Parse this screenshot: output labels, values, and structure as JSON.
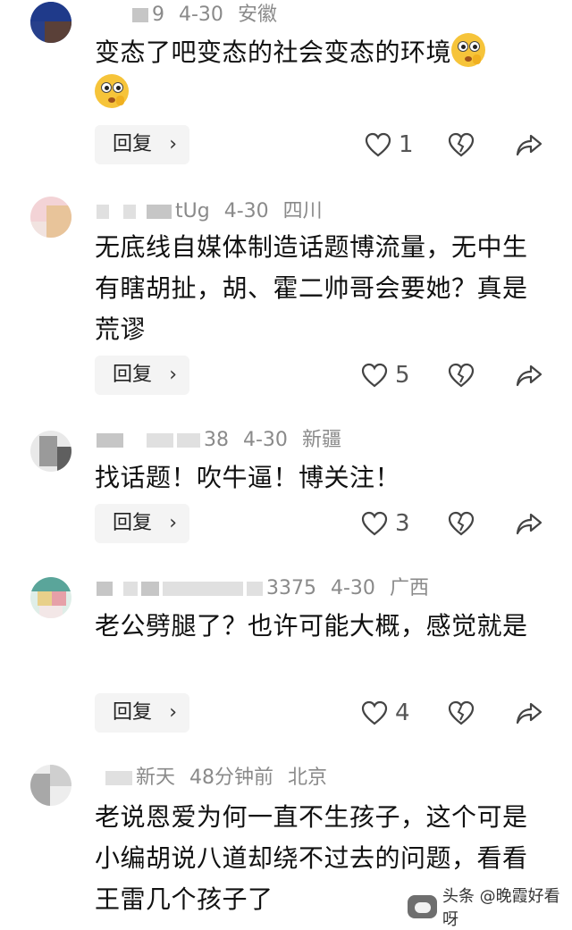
{
  "comments": [
    {
      "name_visible": "9",
      "date": "4-30",
      "location": "安徽",
      "text": "变态了吧变态的社会变态的环境",
      "likes": "1",
      "reply_label": "回复"
    },
    {
      "name_visible": "tUg",
      "date": "4-30",
      "location": "四川",
      "text": "无底线自媒体制造话题博流量，无中生有瞎胡扯，胡、霍二帅哥会要她？真是荒谬",
      "likes": "5",
      "reply_label": "回复"
    },
    {
      "name_visible": "38",
      "date": "4-30",
      "location": "新疆",
      "text": "找话题！吹牛逼！博关注！",
      "likes": "3",
      "reply_label": "回复"
    },
    {
      "name_visible": "3375",
      "date": "4-30",
      "location": "广西",
      "text": "老公劈腿了？也许可能大概，感觉就是",
      "likes": "4",
      "reply_label": "回复"
    },
    {
      "name_visible": "新天",
      "date": "48分钟前",
      "location": "北京",
      "text": "老说恩爱为何一直不生孩子，这个可是小编胡说八道却绕不过去的问题，看看王雷几个孩子了",
      "reply_label": "回复"
    }
  ],
  "icons": {
    "like": "heart-outline-icon",
    "dislike": "broken-heart-icon",
    "share": "share-arrow-icon",
    "chevron": "chevron-right-icon"
  },
  "watermark": {
    "text": "头条 @晚霞好看呀"
  },
  "colors": {
    "meta": "#8a8a8a",
    "reply_bg": "#f4f4f4",
    "icon": "#444444"
  }
}
